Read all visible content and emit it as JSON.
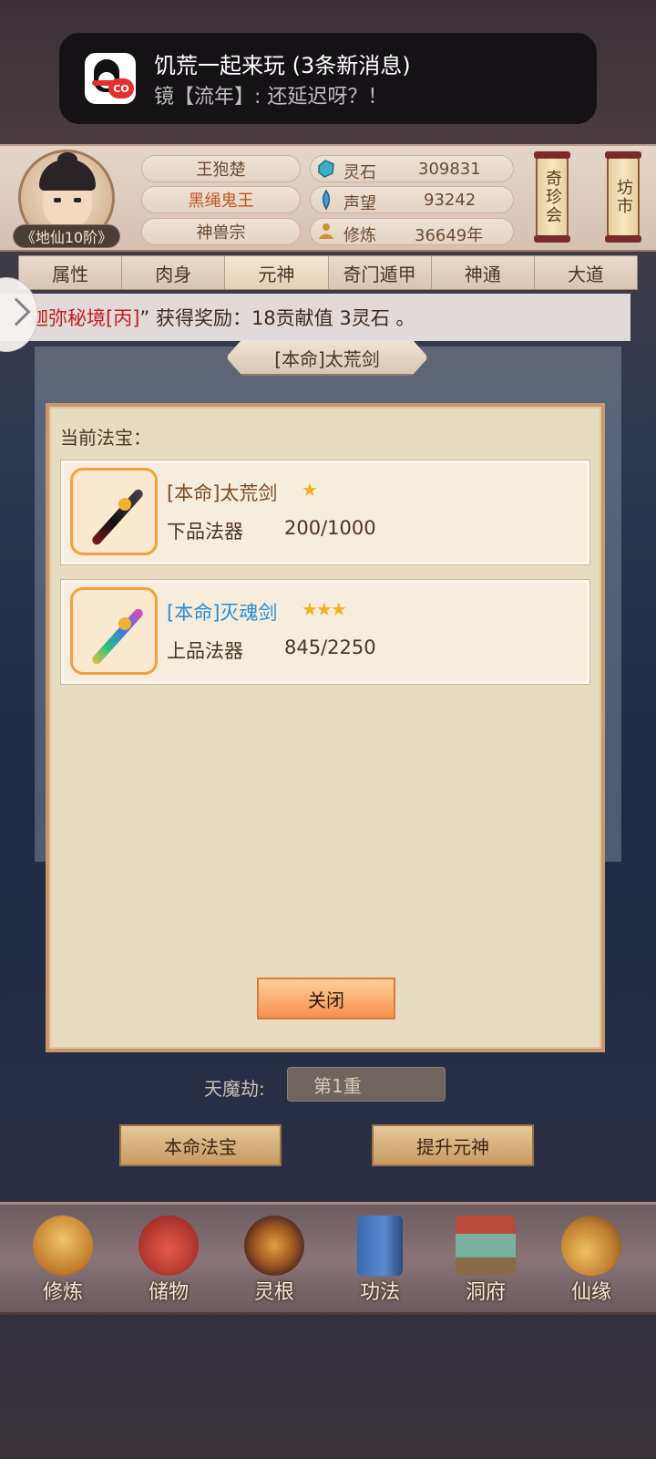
{
  "notification": {
    "title": "饥荒一起来玩 (3条新消息)",
    "body": "镜【流年】: 还延迟呀？！",
    "badge": "CO"
  },
  "player": {
    "name": "王狍楚",
    "title": "黑绳鬼王",
    "sect": "神兽宗",
    "rank": "《地仙10阶》"
  },
  "stats": [
    {
      "label": "灵石",
      "value": "309831",
      "icon": "spirit-stone-icon"
    },
    {
      "label": "声望",
      "value": "93242",
      "icon": "reputation-icon"
    },
    {
      "label": "修炼",
      "value": "36649年",
      "icon": "cultivation-icon"
    }
  ],
  "lanterns": {
    "treasure_fair": "奇珍会",
    "market": "坊市"
  },
  "tabs": [
    "属性",
    "肉身",
    "元神",
    "奇门遁甲",
    "神通",
    "大道"
  ],
  "active_tab": "元神",
  "banner": {
    "highlight": "迦弥秘境[丙]",
    "prefix_quote": "",
    "text": "” 获得奖励：18贡献值 3灵石 。"
  },
  "panel_title": "[本命]太荒剑",
  "dialog": {
    "heading": "当前法宝：",
    "items": [
      {
        "name": "[本命]太荒剑",
        "stars": "★",
        "grade": "下品法器",
        "progress": "200/1000",
        "name_color": "#7a4b26"
      },
      {
        "name": "[本命]灭魂剑",
        "stars": "★★★",
        "grade": "上品法器",
        "progress": "845/2250",
        "name_color": "#2b8dcf"
      }
    ],
    "close_label": "关闭"
  },
  "tribulation": {
    "label": "天魔劫:",
    "value": "第1重"
  },
  "buttons": {
    "natal_treasure": "本命法宝",
    "upgrade_spirit": "提升元神"
  },
  "bottom_nav": [
    "修炼",
    "储物",
    "灵根",
    "功法",
    "洞府",
    "仙缘"
  ]
}
